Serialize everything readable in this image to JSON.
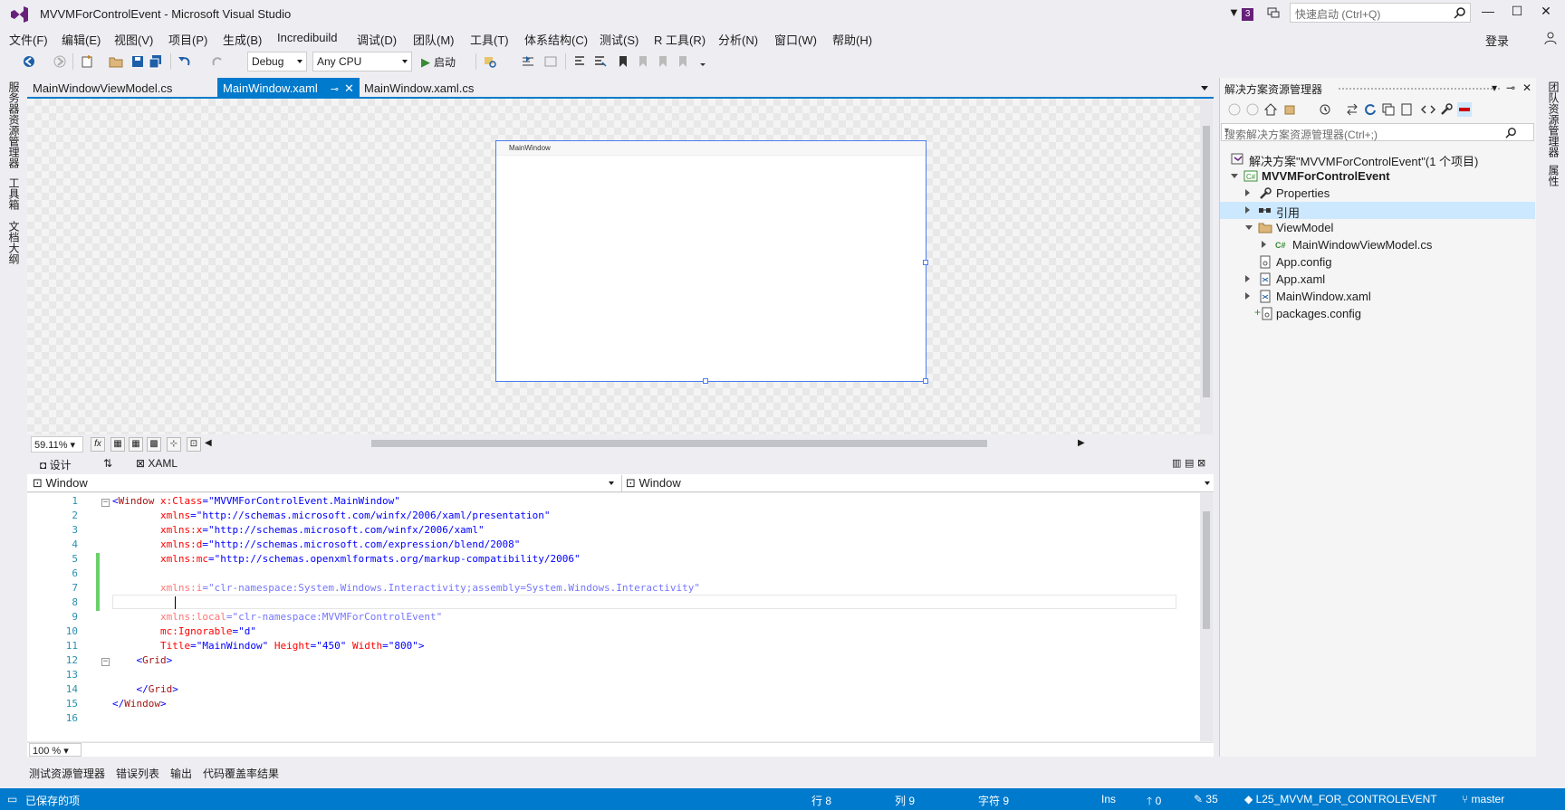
{
  "app": {
    "title": "MVVMForControlEvent - Microsoft Visual Studio",
    "notification_count": "3",
    "quick_launch_placeholder": "快速启动 (Ctrl+Q)",
    "login": "登录",
    "accent": "#007acc",
    "logo_color": "#68217a"
  },
  "menu": [
    "文件(F)",
    "编辑(E)",
    "视图(V)",
    "项目(P)",
    "生成(B)",
    "Incredibuild",
    "调试(D)",
    "团队(M)",
    "工具(T)",
    "体系结构(C)",
    "测试(S)",
    "R 工具(R)",
    "分析(N)",
    "窗口(W)",
    "帮助(H)"
  ],
  "toolbar": {
    "config": "Debug",
    "platform": "Any CPU",
    "start": "启动"
  },
  "left_rail": [
    "服务器资源管理器",
    "工具箱",
    "文档大纲"
  ],
  "right_rail": [
    "团队资源管理器",
    "属性"
  ],
  "doc_tabs": [
    {
      "label": "MainWindowViewModel.cs",
      "active": false
    },
    {
      "label": "MainWindow.xaml",
      "active": true
    },
    {
      "label": "MainWindow.xaml.cs",
      "active": false
    }
  ],
  "designer": {
    "window_title": "MainWindow",
    "zoom": "59.11%",
    "fx_label": "fx"
  },
  "split": {
    "design": "设计",
    "swap": "⇅",
    "xaml": "XAML"
  },
  "nav": {
    "left": "Window",
    "right": "Window"
  },
  "code_lines": [
    {
      "n": "1",
      "tokens": [
        [
          "br",
          "<"
        ],
        [
          "tag",
          "Window"
        ],
        [
          "sp",
          " "
        ],
        [
          "attr",
          "x:Class"
        ],
        [
          "br",
          "=\""
        ],
        [
          "val",
          "MVVMForControlEvent.MainWindow"
        ],
        [
          "br",
          "\""
        ]
      ]
    },
    {
      "n": "2",
      "tokens": [
        [
          "sp",
          "        "
        ],
        [
          "attr",
          "xmlns"
        ],
        [
          "br",
          "=\""
        ],
        [
          "val",
          "http://schemas.microsoft.com/winfx/2006/xaml/presentation"
        ],
        [
          "br",
          "\""
        ]
      ]
    },
    {
      "n": "3",
      "tokens": [
        [
          "sp",
          "        "
        ],
        [
          "attr",
          "xmlns:x"
        ],
        [
          "br",
          "=\""
        ],
        [
          "val",
          "http://schemas.microsoft.com/winfx/2006/xaml"
        ],
        [
          "br",
          "\""
        ]
      ]
    },
    {
      "n": "4",
      "tokens": [
        [
          "sp",
          "        "
        ],
        [
          "attr",
          "xmlns:d"
        ],
        [
          "br",
          "=\""
        ],
        [
          "val",
          "http://schemas.microsoft.com/expression/blend/2008"
        ],
        [
          "br",
          "\""
        ]
      ]
    },
    {
      "n": "5",
      "tokens": [
        [
          "sp",
          "        "
        ],
        [
          "attr",
          "xmlns:mc"
        ],
        [
          "br",
          "=\""
        ],
        [
          "val",
          "http://schemas.openxmlformats.org/markup-compatibility/2006"
        ],
        [
          "br",
          "\""
        ]
      ]
    },
    {
      "n": "6",
      "tokens": []
    },
    {
      "n": "7",
      "tokens": [
        [
          "sp",
          "        "
        ],
        [
          "attrd",
          "xmlns:i"
        ],
        [
          "brd",
          "=\""
        ],
        [
          "vald",
          "clr-namespace:System.Windows.Interactivity;assembly=System.Windows.Interactivity"
        ],
        [
          "brd",
          "\""
        ]
      ]
    },
    {
      "n": "8",
      "tokens": [
        [
          "sp",
          "        "
        ]
      ]
    },
    {
      "n": "9",
      "tokens": [
        [
          "sp",
          "        "
        ],
        [
          "attrd",
          "xmlns:local"
        ],
        [
          "brd",
          "=\""
        ],
        [
          "vald",
          "clr-namespace:MVVMForControlEvent"
        ],
        [
          "brd",
          "\""
        ]
      ]
    },
    {
      "n": "10",
      "tokens": [
        [
          "sp",
          "        "
        ],
        [
          "attr",
          "mc:Ignorable"
        ],
        [
          "br",
          "=\""
        ],
        [
          "val",
          "d"
        ],
        [
          "br",
          "\""
        ]
      ]
    },
    {
      "n": "11",
      "tokens": [
        [
          "sp",
          "        "
        ],
        [
          "attr",
          "Title"
        ],
        [
          "br",
          "=\""
        ],
        [
          "val",
          "MainWindow"
        ],
        [
          "br",
          "\" "
        ],
        [
          "attr",
          "Height"
        ],
        [
          "br",
          "=\""
        ],
        [
          "val",
          "450"
        ],
        [
          "br",
          "\" "
        ],
        [
          "attr",
          "Width"
        ],
        [
          "br",
          "=\""
        ],
        [
          "val",
          "800"
        ],
        [
          "br",
          "\">"
        ]
      ]
    },
    {
      "n": "12",
      "tokens": [
        [
          "sp",
          "    "
        ],
        [
          "br",
          "<"
        ],
        [
          "tag",
          "Grid"
        ],
        [
          "br",
          ">"
        ]
      ]
    },
    {
      "n": "13",
      "tokens": []
    },
    {
      "n": "14",
      "tokens": [
        [
          "sp",
          "    "
        ],
        [
          "br",
          "</"
        ],
        [
          "tag",
          "Grid"
        ],
        [
          "br",
          ">"
        ]
      ]
    },
    {
      "n": "15",
      "tokens": [
        [
          "br",
          "</"
        ],
        [
          "tag",
          "Window"
        ],
        [
          "br",
          ">"
        ]
      ]
    },
    {
      "n": "16",
      "tokens": []
    }
  ],
  "editor_zoom": "100 %",
  "bottom_tabs": [
    "测试资源管理器",
    "错误列表",
    "输出",
    "代码覆盖率结果"
  ],
  "solution_explorer": {
    "title": "解决方案资源管理器",
    "search_placeholder": "搜索解决方案资源管理器(Ctrl+;)",
    "items": [
      {
        "label": "解决方案\"MVVMForControlEvent\"(1 个项目)",
        "icon": "solution-icon",
        "bold": false
      },
      {
        "label": "MVVMForControlEvent",
        "icon": "csharp-project-icon",
        "bold": true
      },
      {
        "label": "Properties",
        "icon": "wrench-icon",
        "bold": false
      },
      {
        "label": "引用",
        "icon": "references-icon",
        "bold": false
      },
      {
        "label": "ViewModel",
        "icon": "folder-icon",
        "bold": false
      },
      {
        "label": "MainWindowViewModel.cs",
        "icon": "csharp-file-icon",
        "bold": false
      },
      {
        "label": "App.config",
        "icon": "config-file-icon",
        "bold": false
      },
      {
        "label": "App.xaml",
        "icon": "xaml-file-icon",
        "bold": false
      },
      {
        "label": "MainWindow.xaml",
        "icon": "xaml-file-icon",
        "bold": false
      },
      {
        "label": "packages.config",
        "icon": "config-file-icon",
        "bold": false
      }
    ]
  },
  "status": {
    "saved": "已保存的项",
    "line": "行 8",
    "col": "列 9",
    "char": "字符 9",
    "ins": "Ins",
    "up": "0",
    "pencil": "35",
    "branch_repo": "L25_MVVM_FOR_CONTROLEVENT",
    "branch": "master"
  }
}
